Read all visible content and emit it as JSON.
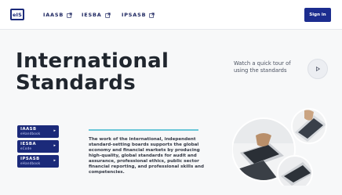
{
  "header": {
    "logo_text": "eIS",
    "nav": [
      {
        "label": "IAASB"
      },
      {
        "label": "IESBA"
      },
      {
        "label": "IPSASB"
      }
    ],
    "signin_label": "Sign in"
  },
  "hero": {
    "title_line1": "International",
    "title_line2": "Standards",
    "tour_text": "Watch a quick tour of using the standards"
  },
  "cards": [
    {
      "title": "IAASB",
      "subtitle": "eHandbook"
    },
    {
      "title": "IESBA",
      "subtitle": "eCode"
    },
    {
      "title": "IPSASB",
      "subtitle": "eHandbook"
    }
  ],
  "description": "The work of the international, independent standard-setting boards supports the global economy and financial markets by producing high-quality, global standards for audit and assurance, professional ethics, public sector financial reporting, and professional skills and competencies.",
  "colors": {
    "brand": "#1b2a7a",
    "accent": "#69c7d8"
  }
}
